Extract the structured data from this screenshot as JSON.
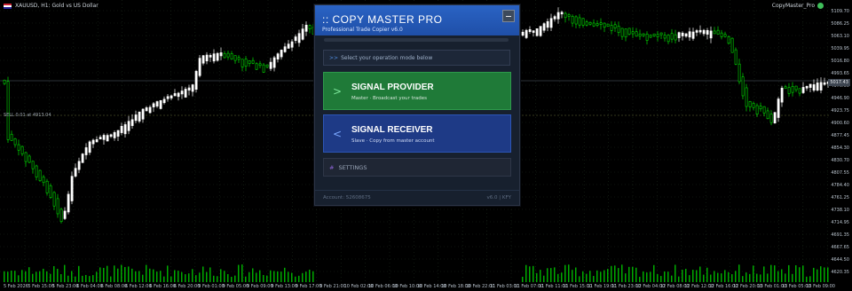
{
  "chart": {
    "symbol_label": "XAUUSD, H1: Gold vs US Dollar",
    "expert_label": "CopyMaster_Pro",
    "current_price": "5017.43",
    "sl_label": "SELL 0.01 at 4913.04",
    "price_levels": [
      "5109.70",
      "5086.25",
      "5063.10",
      "5039.95",
      "5016.80",
      "4993.65",
      "4970.50",
      "4946.90",
      "4923.75",
      "4900.60",
      "4877.45",
      "4854.30",
      "4830.70",
      "4807.55",
      "4784.40",
      "4761.25",
      "4738.10",
      "4714.95",
      "4691.35",
      "4667.65",
      "4644.50",
      "4620.35"
    ],
    "time_labels": [
      "5 Feb 2026",
      "5 Feb 15:00",
      "5 Feb 23:00",
      "6 Feb 04:00",
      "6 Feb 08:00",
      "6 Feb 12:00",
      "6 Feb 16:00",
      "6 Feb 20:00",
      "9 Feb 01:00",
      "9 Feb 05:00",
      "9 Feb 09:00",
      "9 Feb 13:00",
      "9 Feb 17:00",
      "9 Feb 21:00",
      "10 Feb 02:00",
      "10 Feb 06:00",
      "10 Feb 10:00",
      "10 Feb 14:00",
      "10 Feb 18:00",
      "10 Feb 22:00",
      "11 Feb 03:00",
      "11 Feb 07:00",
      "11 Feb 11:00",
      "11 Feb 15:00",
      "11 Feb 19:00",
      "11 Feb 23:00",
      "12 Feb 04:00",
      "12 Feb 08:00",
      "12 Feb 12:00",
      "12 Feb 16:00",
      "12 Feb 20:00",
      "13 Feb 01:00",
      "13 Feb 05:00",
      "13 Feb 09:00"
    ],
    "colors": {
      "up": "#ffffff",
      "down": "#00dd00",
      "volume": "#00aa00",
      "grid": "#1c2a1c"
    }
  },
  "panel": {
    "title": ":: COPY MASTER PRO",
    "subtitle": "Professional Trade Copier v6.0",
    "status_prefix": ">>",
    "status_text": "Select your operation mode below",
    "provider": {
      "arrow": ">",
      "title": "SIGNAL PROVIDER",
      "desc": "Master · Broadcast your trades"
    },
    "receiver": {
      "arrow": "<",
      "title": "SIGNAL RECEIVER",
      "desc": "Slave · Copy from master account"
    },
    "settings": {
      "icon": "#",
      "label": "SETTINGS"
    },
    "footer": {
      "account": "Account: 52608675",
      "version": "v6.0 | KFY"
    }
  }
}
